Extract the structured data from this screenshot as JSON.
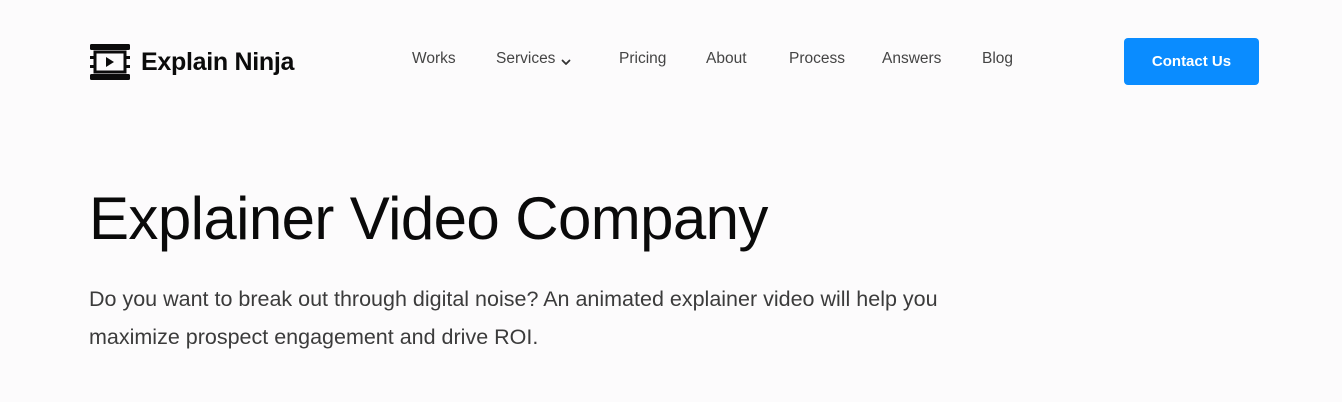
{
  "brand": {
    "name": "Explain Ninja",
    "icon": "film-play-icon"
  },
  "nav": {
    "items": [
      {
        "label": "Works"
      },
      {
        "label": "Services",
        "has_dropdown": true
      },
      {
        "label": "Pricing"
      },
      {
        "label": "About"
      },
      {
        "label": "Process"
      },
      {
        "label": "Answers"
      },
      {
        "label": "Blog"
      }
    ]
  },
  "cta": {
    "label": "Contact Us",
    "color": "#0a8cff"
  },
  "hero": {
    "title": "Explainer Video Company",
    "subtitle": "Do you want to break out through digital noise? An animated explainer video will help you maximize prospect engagement and drive ROI."
  }
}
